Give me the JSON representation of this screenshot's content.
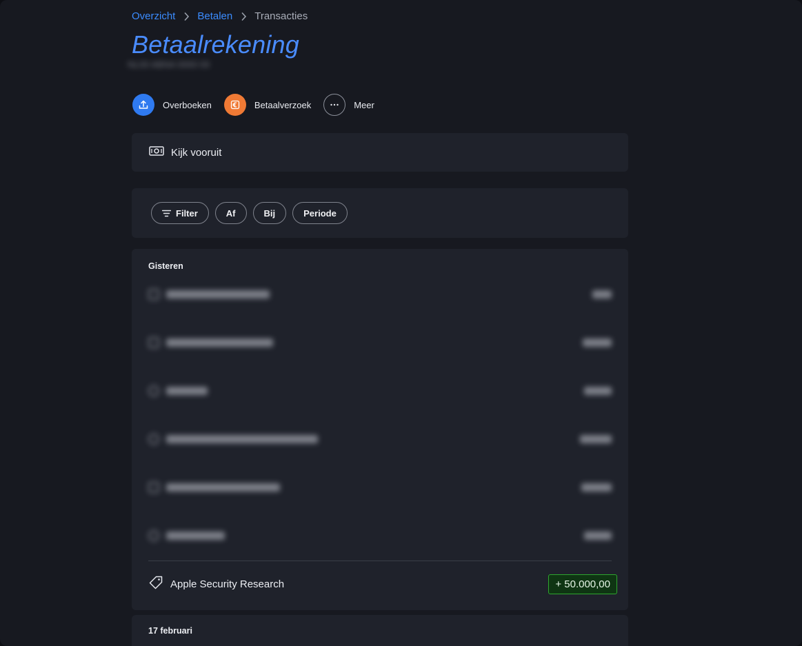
{
  "breadcrumb": {
    "items": [
      {
        "label": "Overzicht",
        "link": true
      },
      {
        "label": "Betalen",
        "link": true
      },
      {
        "label": "Transacties",
        "link": false
      }
    ]
  },
  "page": {
    "title": "Betaalrekening",
    "account_number": "NL00 ABNA 0000 00"
  },
  "actions": [
    {
      "label": "Overboeken",
      "icon": "upload-icon",
      "color": "#2f7af0"
    },
    {
      "label": "Betaalverzoek",
      "icon": "euro-icon",
      "color": "#f07a35"
    },
    {
      "label": "Meer",
      "icon": "more-icon",
      "color": "#8c909a"
    }
  ],
  "forecast": {
    "label": "Kijk vooruit",
    "icon": "banknote-icon"
  },
  "filters": {
    "filter_label": "Filter",
    "af_label": "Af",
    "bij_label": "Bij",
    "periode_label": "Periode"
  },
  "transactions": {
    "section_title": "Gisteren",
    "highlight": {
      "name": "Apple Security Research",
      "amount": "+ 50.000,00",
      "icon": "tag-icon",
      "amount_color": "#2ea72e"
    }
  },
  "next_section": {
    "title": "17 februari"
  }
}
